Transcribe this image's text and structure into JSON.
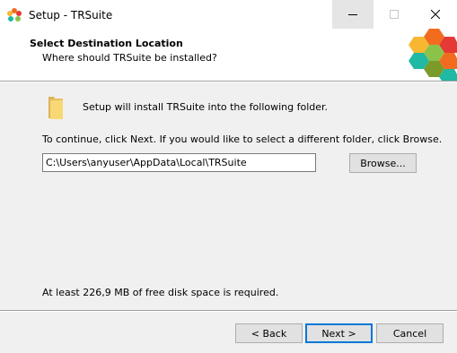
{
  "window": {
    "title": "Setup - TRSuite",
    "controls": {
      "minimize_icon": "minimize-icon",
      "maximize_icon": "maximize-icon",
      "close_icon": "close-icon"
    }
  },
  "header": {
    "title": "Select Destination Location",
    "subtitle": "Where should TRSuite be installed?"
  },
  "main": {
    "intro": "Setup will install TRSuite into the following folder.",
    "instruction": "To continue, click Next. If you would like to select a different folder, click Browse.",
    "path_value": "C:\\Users\\anyuser\\AppData\\Local\\TRSuite",
    "browse_label": "Browse...",
    "disk_space": "At least 226,9 MB of free disk space is required."
  },
  "footer": {
    "back_label": "< Back",
    "next_label": "Next >",
    "cancel_label": "Cancel"
  },
  "colors": {
    "logo_orange": "#f26c1f",
    "logo_yellow": "#f7b731",
    "logo_green": "#8bc34a",
    "logo_red": "#e53935",
    "logo_teal": "#1fb9a4",
    "logo_olive": "#7a9a2a",
    "focus_blue": "#0078d7"
  }
}
